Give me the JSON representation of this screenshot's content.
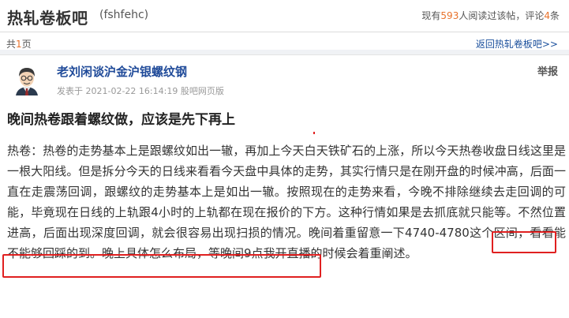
{
  "header": {
    "bar_title": "热轧卷板吧",
    "bar_id": "(fshfehc)",
    "stats_prefix": "现有",
    "readers": "593",
    "stats_mid": "人阅读过该帖，评论",
    "comments": "4",
    "stats_suffix": "条"
  },
  "pager": {
    "prefix": "共",
    "pages": "1",
    "suffix": "页"
  },
  "back_link": "返回热轧卷板吧>>",
  "post": {
    "author": "老刘闲谈沪金沪银螺纹钢",
    "meta": "发表于 2021-02-22 16:14:19 股吧网页版",
    "report": "举报",
    "title": "晚间热卷跟着螺纹做，应该是先下再上",
    "body_part1": "热卷：热卷的走势基本上是跟螺纹如出一辙，再加上今天白天铁矿石的上涨，所以今天热卷收盘日线这里是一根大阳线。但是拆分今天的日线来看看今天盘中具体的走势，其实行情只是在刚开盘的时候冲高，后面一直在走震荡回调，跟螺纹的走势基本上是如出一辙。按照现在的走势来看，今晚不排除继续去走回调的可能，毕竟现在日线的上轨跟4小时的上轨都在现在报价的下方。这种行情如果是去抓底就只能等。不然位置进高，后面出现深度回调，就会很容易出现扫损的情况。",
    "body_highlight": "晚间着重留意一下4740-4780这个区间，看看能不能够回踩的到。",
    "body_part2": "晚上具体怎么布局，等晚间9点我开直播的时候会着重阐述。"
  },
  "colors": {
    "accent_orange": "#e8722b",
    "link_blue": "#1a4f9c",
    "highlight_red": "#e02020"
  }
}
